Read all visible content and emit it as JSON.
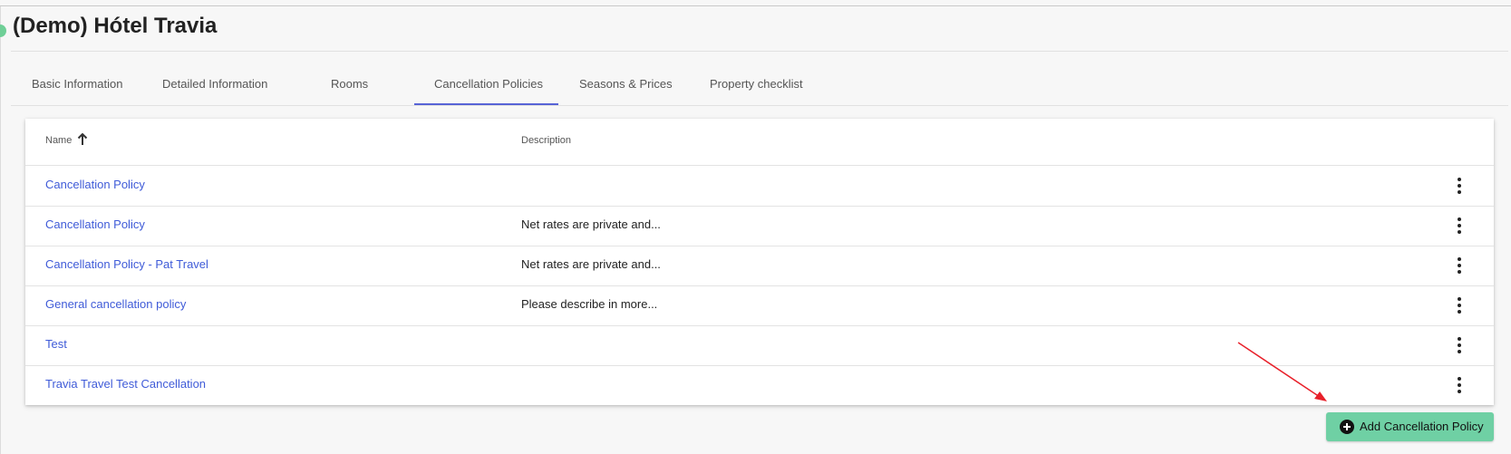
{
  "header": {
    "title": "(Demo) Hótel Travia"
  },
  "tabs": [
    {
      "label": "Basic Information",
      "active": false
    },
    {
      "label": "Detailed Information",
      "active": false
    },
    {
      "label": "Rooms",
      "active": false
    },
    {
      "label": "Cancellation Policies",
      "active": true
    },
    {
      "label": "Seasons & Prices",
      "active": false
    },
    {
      "label": "Property checklist",
      "active": false
    }
  ],
  "table": {
    "columns": [
      {
        "label": "Name",
        "sort": "ascending"
      },
      {
        "label": "Description"
      }
    ],
    "rows": [
      {
        "name": "Cancellation Policy",
        "description": ""
      },
      {
        "name": "Cancellation Policy",
        "description": "Net rates are private and..."
      },
      {
        "name": "Cancellation Policy - Pat Travel",
        "description": "Net rates are private and..."
      },
      {
        "name": "General cancellation policy",
        "description": "Please describe in more..."
      },
      {
        "name": "Test",
        "description": ""
      },
      {
        "name": "Travia Travel Test Cancellation",
        "description": ""
      }
    ]
  },
  "actions": {
    "add_label": "Add Cancellation Policy"
  },
  "colors": {
    "accent": "#5763d6",
    "link": "#3f5bd8",
    "add_button": "#6fd0a4",
    "annotation_arrow": "#e8202a"
  },
  "icons": {
    "sort": "arrow-up-icon",
    "row_menu": "more-vertical-icon",
    "add": "plus-circle-icon"
  }
}
